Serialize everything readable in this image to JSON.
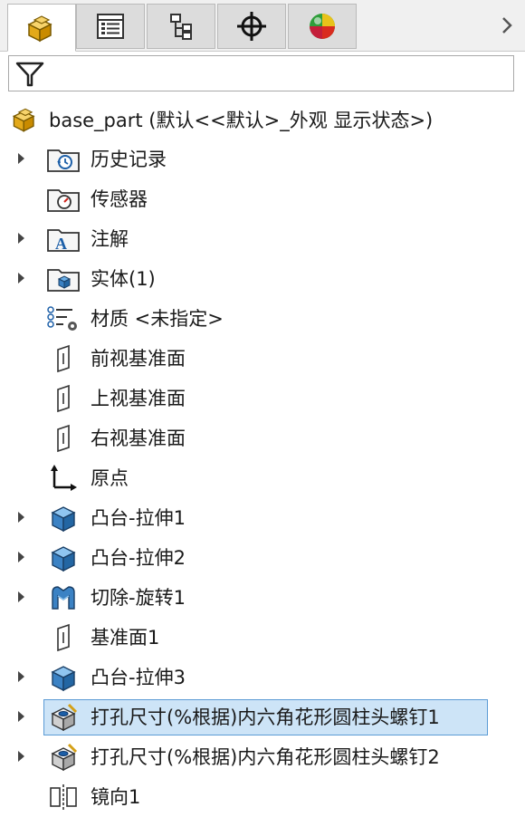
{
  "tabs": [
    {
      "name": "feature-manager",
      "icon": "part-cubes-icon",
      "active": true
    },
    {
      "name": "property-manager",
      "icon": "property-list-icon",
      "active": false
    },
    {
      "name": "configuration-manager",
      "icon": "configuration-icon",
      "active": false
    },
    {
      "name": "dimxpert-manager",
      "icon": "crosshair-icon",
      "active": false
    },
    {
      "name": "display-manager",
      "icon": "appearance-sphere-icon",
      "active": false
    }
  ],
  "filter": {
    "icon": "funnel-filter-icon"
  },
  "root": {
    "label": "base_part  (默认<<默认>_外观 显示状态>)",
    "icon": "part-cubes-icon"
  },
  "tree": [
    {
      "label": "历史记录",
      "icon": "history-folder-icon",
      "expandable": true
    },
    {
      "label": "传感器",
      "icon": "sensor-folder-icon",
      "expandable": false
    },
    {
      "label": "注解",
      "icon": "annotation-folder-icon",
      "expandable": true
    },
    {
      "label": "实体(1)",
      "icon": "solid-body-folder-icon",
      "expandable": true
    },
    {
      "label": "材质 <未指定>",
      "icon": "material-icon",
      "expandable": false
    },
    {
      "label": "前视基准面",
      "icon": "plane-icon",
      "expandable": false
    },
    {
      "label": "上视基准面",
      "icon": "plane-icon",
      "expandable": false
    },
    {
      "label": "右视基准面",
      "icon": "plane-icon",
      "expandable": false
    },
    {
      "label": "原点",
      "icon": "origin-icon",
      "expandable": false
    },
    {
      "label": "凸台-拉伸1",
      "icon": "boss-extrude-icon",
      "expandable": true
    },
    {
      "label": "凸台-拉伸2",
      "icon": "boss-extrude-icon",
      "expandable": true
    },
    {
      "label": "切除-旋转1",
      "icon": "cut-revolve-icon",
      "expandable": true
    },
    {
      "label": "基准面1",
      "icon": "plane-icon",
      "expandable": false
    },
    {
      "label": "凸台-拉伸3",
      "icon": "boss-extrude-icon",
      "expandable": true
    },
    {
      "label": "打孔尺寸(%根据)内六角花形圆柱头螺钉1",
      "icon": "hole-wizard-icon",
      "expandable": true,
      "selected": true
    },
    {
      "label": "打孔尺寸(%根据)内六角花形圆柱头螺钉2",
      "icon": "hole-wizard-icon",
      "expandable": true
    },
    {
      "label": "镜向1",
      "icon": "mirror-icon",
      "expandable": false
    }
  ],
  "colors": {
    "selection_fill": "#cde4f7",
    "selection_border": "#5b9bd5",
    "tab_bg": "#dcdcdc"
  }
}
